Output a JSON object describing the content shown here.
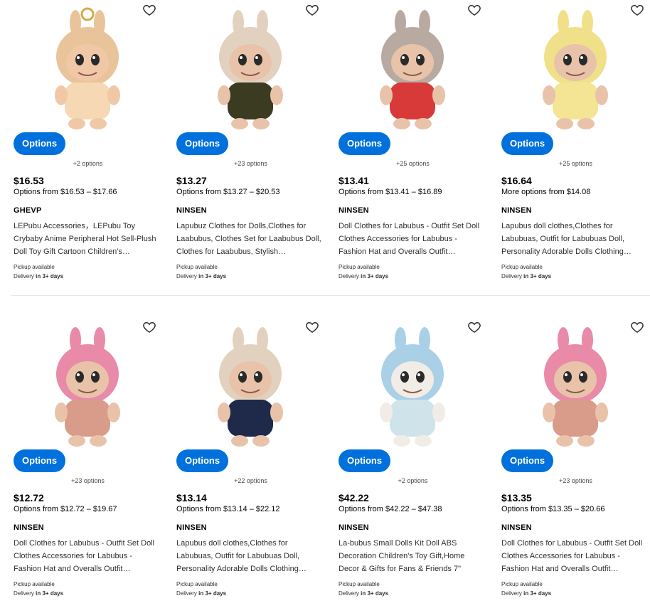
{
  "products": [
    {
      "options_label": "Options",
      "more_options": "+2 options",
      "price": "$16.53",
      "price_range": "Options from $16.53 – $17.66",
      "brand": "GHEVP",
      "title": "LEPubu Accessories，LEPubu Toy Crybaby Anime Peripheral Hot Sell-Plush Doll Toy Gift Cartoon Children's…",
      "pickup": "Pickup available",
      "delivery_prefix": "Delivery",
      "delivery_time": "in 3+ days",
      "icon": "heart-icon",
      "image": {
        "body": "#f6d9b4",
        "accent": "#e9c49a",
        "face": "#f0c8a8"
      }
    },
    {
      "options_label": "Options",
      "more_options": "+23 options",
      "price": "$13.27",
      "price_range": "Options from $13.27 – $20.53",
      "brand": "NINSEN",
      "title": "Lapubuz Clothes for Dolls,Clothes for Laabubus, Clothes Set for Laabubus Doll, Clothes for Laabubus, Stylish…",
      "pickup": "Pickup available",
      "delivery_prefix": "Delivery",
      "delivery_time": "in 3+ days",
      "icon": "heart-icon",
      "image": {
        "body": "#3b3b22",
        "accent": "#e3d1bf",
        "face": "#e8c3a9"
      }
    },
    {
      "options_label": "Options",
      "more_options": "+25 options",
      "price": "$13.41",
      "price_range": "Options from $13.41 – $16.89",
      "brand": "NINSEN",
      "title": "Doll Clothes for Labubus - Outfit Set Doll Clothes Accessories for Labubus - Fashion Hat and Overalls Outfit…",
      "pickup": "Pickup available",
      "delivery_prefix": "Delivery",
      "delivery_time": "in 3+ days",
      "icon": "heart-icon",
      "image": {
        "body": "#d83a3a",
        "accent": "#b8aaa0",
        "face": "#e8c3a9"
      }
    },
    {
      "options_label": "Options",
      "more_options": "+25 options",
      "price": "$16.64",
      "price_range": "More options from $14.08",
      "brand": "NINSEN",
      "title": "Lapubus doll clothes,Clothes for Labubuas, Outfit for Labubuas Doll, Personality Adorable Dolls Clothing…",
      "pickup": "Pickup available",
      "delivery_prefix": "Delivery",
      "delivery_time": "in 3+ days",
      "icon": "heart-icon",
      "image": {
        "body": "#f3e594",
        "accent": "#f1e08a",
        "face": "#e8c3a9"
      }
    },
    {
      "options_label": "Options",
      "more_options": "+23 options",
      "price": "$12.72",
      "price_range": "Options from $12.72 – $19.67",
      "brand": "NINSEN",
      "title": "Doll Clothes for Labubus - Outfit Set Doll Clothes Accessories for Labubus - Fashion Hat and Overalls Outfit…",
      "pickup": "Pickup available",
      "delivery_prefix": "Delivery",
      "delivery_time": "in 3+ days",
      "icon": "heart-icon",
      "image": {
        "body": "#d99c8a",
        "accent": "#e88aa8",
        "face": "#e8c3a9"
      }
    },
    {
      "options_label": "Options",
      "more_options": "+22 options",
      "price": "$13.14",
      "price_range": "Options from $13.14 – $22.12",
      "brand": "NINSEN",
      "title": "Lapubus doll clothes,Clothes for Labubuas, Outfit for Labubuas Doll, Personality Adorable Dolls Clothing…",
      "pickup": "Pickup available",
      "delivery_prefix": "Delivery",
      "delivery_time": "in 3+ days",
      "icon": "heart-icon",
      "image": {
        "body": "#1f2a4a",
        "accent": "#e3d1bf",
        "face": "#e8c3a9"
      }
    },
    {
      "options_label": "Options",
      "more_options": "+2 options",
      "price": "$42.22",
      "price_range": "Options from $42.22 – $47.38",
      "brand": "NINSEN",
      "title": "La-bubus Small Dolls Kit Doll ABS Decoration Children's Toy Gift,Home Decor & Gifts for Fans & Friends 7\"",
      "pickup": "Pickup available",
      "delivery_prefix": "Delivery",
      "delivery_time": "in 3+ days",
      "icon": "heart-icon",
      "image": {
        "body": "#cfe3ea",
        "accent": "#a9d0e6",
        "face": "#f2ece6"
      }
    },
    {
      "options_label": "Options",
      "more_options": "+23 options",
      "price": "$13.35",
      "price_range": "Options from $13.35 – $20.66",
      "brand": "NINSEN",
      "title": "Doll Clothes for Labubus - Outfit Set Doll Clothes Accessories for Labubus - Fashion Hat and Overalls Outfit…",
      "pickup": "Pickup available",
      "delivery_prefix": "Delivery",
      "delivery_time": "in 3+ days",
      "icon": "heart-icon",
      "image": {
        "body": "#d99c8a",
        "accent": "#e88aa8",
        "face": "#e8c3a9"
      }
    }
  ],
  "colors": {
    "options_button": "#0071dc",
    "divider": "#e6e7e8"
  }
}
